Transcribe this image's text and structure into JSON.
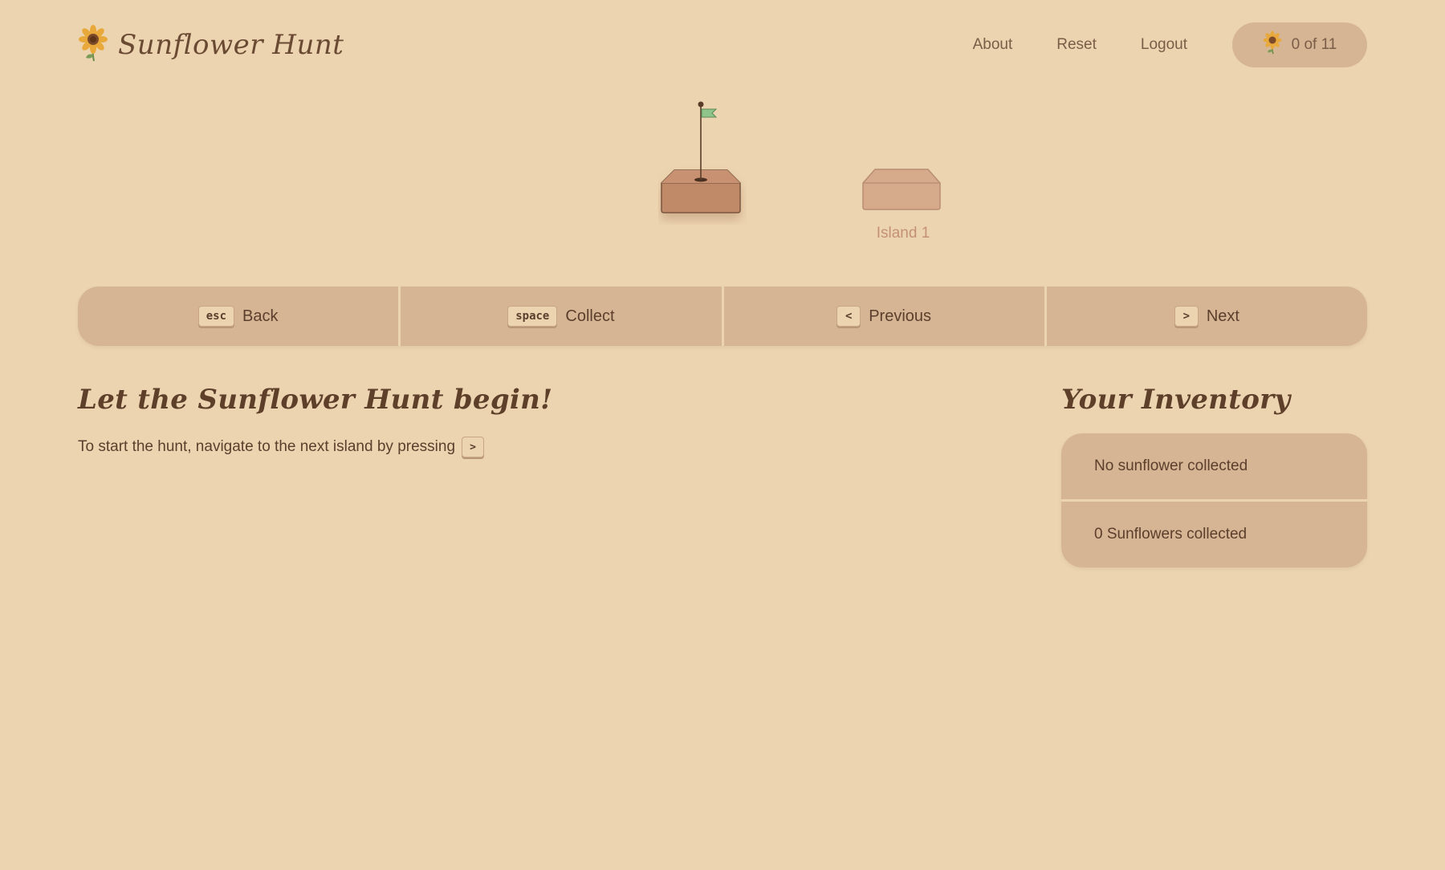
{
  "app": {
    "title": "Sunflower Hunt"
  },
  "nav": {
    "about": "About",
    "reset": "Reset",
    "logout": "Logout",
    "counter": "0 of 11"
  },
  "map": {
    "island_label": "Island 1",
    "flag_color": "#8fc48a"
  },
  "controls": [
    {
      "key": "esc",
      "label": "Back"
    },
    {
      "key": "space",
      "label": "Collect"
    },
    {
      "key": "<",
      "label": "Previous"
    },
    {
      "key": ">",
      "label": "Next"
    }
  ],
  "intro": {
    "heading": "Let the Sunflower Hunt begin!",
    "text": "To start the hunt, navigate to the next island by pressing",
    "key": ">"
  },
  "inventory": {
    "heading": "Your Inventory",
    "items": [
      "No sunflower collected",
      "0 Sunflowers collected"
    ]
  },
  "colors": {
    "background": "#ecd4b0",
    "panel": "#d6b594",
    "text": "#5b3f2c",
    "island_active": "#c08a69",
    "island_inactive": "#d6ab8c",
    "sunflower_petal": "#e8a93a"
  },
  "icons": {
    "logo": "sunflower-icon",
    "counter": "sunflower-icon",
    "flag": "flag-icon"
  }
}
